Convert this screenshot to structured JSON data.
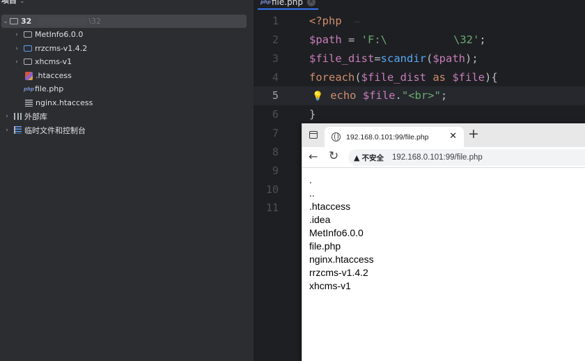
{
  "project": {
    "header": "项目",
    "root": {
      "name": "32",
      "path_suffix": "\\32"
    },
    "items": [
      {
        "label": "MetInfo6.0.0",
        "type": "folder"
      },
      {
        "label": "rrzcms-v1.4.2",
        "type": "folder"
      },
      {
        "label": "xhcms-v1",
        "type": "folder"
      },
      {
        "label": ".htaccess",
        "type": "htaccess"
      },
      {
        "label": "file.php",
        "type": "php"
      },
      {
        "label": "nginx.htaccess",
        "type": "text"
      },
      {
        "label": "外部库",
        "type": "library"
      },
      {
        "label": "临时文件和控制台",
        "type": "scratch"
      }
    ]
  },
  "editor": {
    "tab_label": "file.php",
    "line_numbers": [
      "1",
      "2",
      "3",
      "4",
      "5",
      "6",
      "7",
      "8",
      "9",
      "10",
      "11"
    ],
    "active_line": "5",
    "code": {
      "l1": "<?php",
      "l2_var": "$path",
      "l2_eq": " = ",
      "l2_str_a": "'F:\\",
      "l2_str_b": "\\32'",
      "l2_end": ";",
      "l3_var": "$file_dist",
      "l3_eq": "=",
      "l3_fn": "scandir",
      "l3_open": "(",
      "l3_arg": "$path",
      "l3_close": ");",
      "l4_kw": "foreach",
      "l4_open": "(",
      "l4_var1": "$file_dist",
      "l4_as": " as ",
      "l4_var2": "$file",
      "l4_close": "){",
      "l5_kw": "echo",
      "l5_var": " $file",
      "l5_dot": ".",
      "l5_str": "\"<br>\"",
      "l5_end": ";",
      "l6": "}"
    }
  },
  "browser": {
    "tab_title": "192.168.0.101:99/file.php",
    "insecure_label": "不安全",
    "url": "192.168.0.101:99/file.php",
    "output": [
      ".",
      "..",
      ".htaccess",
      ".idea",
      "MetInfo6.0.0",
      "file.php",
      "nginx.htaccess",
      "rrzcms-v1.4.2",
      "xhcms-v1"
    ]
  }
}
